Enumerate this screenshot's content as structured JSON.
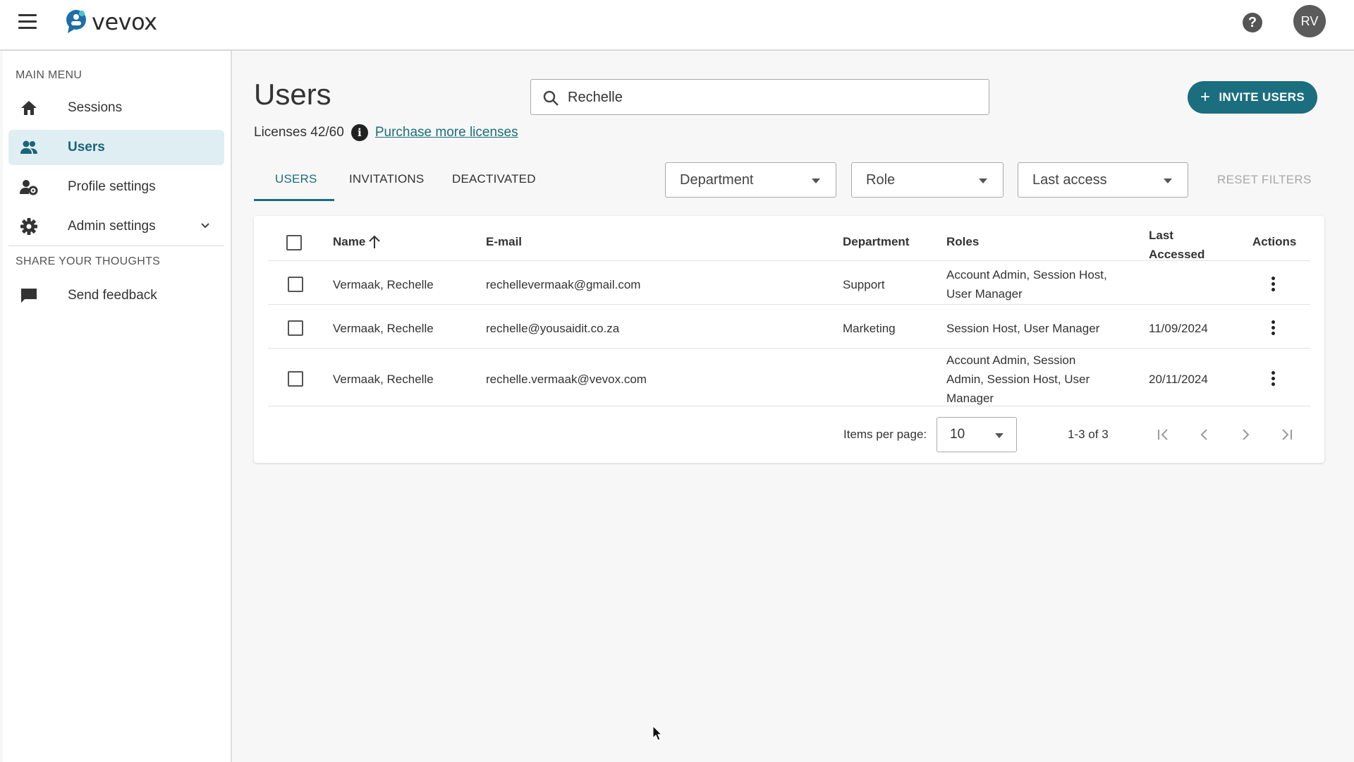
{
  "app": {
    "brand": "vevox",
    "avatar_initials": "RV"
  },
  "sidebar": {
    "main_menu_label": "MAIN MENU",
    "items": [
      {
        "label": "Sessions",
        "icon": "home-icon"
      },
      {
        "label": "Users",
        "icon": "users-icon",
        "active": true
      },
      {
        "label": "Profile settings",
        "icon": "profile-settings-icon"
      },
      {
        "label": "Admin settings",
        "icon": "gear-icon",
        "expandable": true
      }
    ],
    "share_label": "SHARE YOUR THOUGHTS",
    "feedback_label": "Send feedback"
  },
  "header": {
    "title": "Users",
    "search_value": "Rechelle",
    "invite_label": "INVITE USERS",
    "licenses_text": "Licenses 42/60",
    "purchase_link": "Purchase more licenses"
  },
  "tabs": [
    {
      "label": "USERS",
      "active": true
    },
    {
      "label": "INVITATIONS"
    },
    {
      "label": "DEACTIVATED"
    }
  ],
  "filters": {
    "department": "Department",
    "role": "Role",
    "last_access": "Last access",
    "reset": "RESET FILTERS"
  },
  "table": {
    "columns": {
      "name": "Name",
      "email": "E-mail",
      "department": "Department",
      "roles": "Roles",
      "last_accessed_1": "Last",
      "last_accessed_2": "Accessed",
      "actions": "Actions"
    },
    "rows": [
      {
        "name": "Vermaak, Rechelle",
        "email": "rechellevermaak@gmail.com",
        "department": "Support",
        "roles_1": "Account Admin, Session Host,",
        "roles_2": "User Manager",
        "roles_3": "",
        "last_accessed": ""
      },
      {
        "name": "Vermaak, Rechelle",
        "email": "rechelle@yousaidit.co.za",
        "department": "Marketing",
        "roles_1": "Session Host, User Manager",
        "roles_2": "",
        "roles_3": "",
        "last_accessed": "11/09/2024"
      },
      {
        "name": "Vermaak, Rechelle",
        "email": "rechelle.vermaak@vevox.com",
        "department": "",
        "roles_1": "Account Admin, Session",
        "roles_2": "Admin, Session Host, User",
        "roles_3": "Manager",
        "last_accessed": "20/11/2024"
      }
    ]
  },
  "pagination": {
    "items_per_page_label": "Items per page:",
    "items_per_page": "10",
    "range": "1-3 of 3"
  },
  "colors": {
    "accent": "#1b6e7e",
    "active_nav_bg": "#dfeef2"
  }
}
